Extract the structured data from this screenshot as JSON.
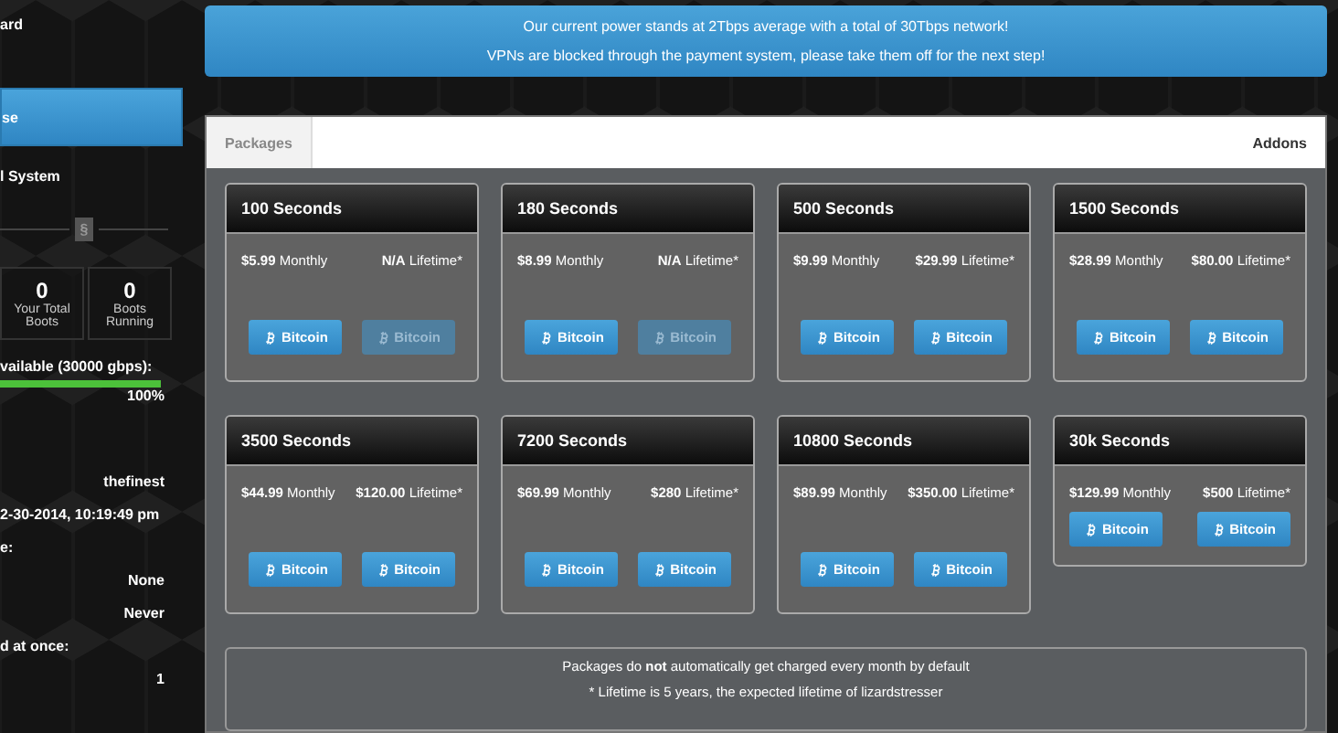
{
  "sidebar": {
    "title": "ard",
    "items": [
      {
        "label": "se",
        "selected": true
      }
    ],
    "section": "l System",
    "divider_badge": "§",
    "stats": [
      {
        "value": "0",
        "label": "Your Total Boots"
      },
      {
        "value": "0",
        "label": "Boots Running"
      }
    ],
    "capacity": {
      "label": "vailable (30000 gbps):",
      "level": 1,
      "reading": "100%"
    },
    "info": [
      {
        "kind": "value",
        "text": "thefinest"
      },
      {
        "kind": "label",
        "text": "2-30-2014, 10:19:49 pm"
      },
      {
        "kind": "label",
        "text": "e:"
      },
      {
        "kind": "value",
        "text": "None"
      },
      {
        "kind": "value",
        "text": "Never"
      },
      {
        "kind": "label",
        "text": "d at once:"
      },
      {
        "kind": "value",
        "text": "1"
      }
    ]
  },
  "banner": [
    "Our current power stands at 2Tbps average with a total of 30Tbps network!",
    "VPNs are blocked through the payment system, please take them off for the next step!"
  ],
  "tabs": [
    {
      "label": "Packages",
      "selected": true
    },
    {
      "label": "Addons",
      "selected": false
    }
  ],
  "packages": [
    {
      "kind": "standard",
      "title": "100 Seconds",
      "monthly": "**$5.99** Monthly",
      "lifetime": "**N/A** Lifetime*",
      "buttons": [
        {
          "label": "Bitcoin",
          "disabled": false
        },
        {
          "label": "Bitcoin",
          "disabled": true
        }
      ]
    },
    {
      "kind": "standard",
      "title": "180 Seconds",
      "monthly": "**$8.99** Monthly",
      "lifetime": "**N/A** Lifetime*",
      "buttons": [
        {
          "label": "Bitcoin",
          "disabled": false
        },
        {
          "label": "Bitcoin",
          "disabled": true
        }
      ]
    },
    {
      "kind": "standard",
      "title": "500 Seconds",
      "monthly": "**$9.99** Monthly",
      "lifetime": "**$29.99** Lifetime*",
      "buttons": [
        {
          "label": "Bitcoin",
          "disabled": false
        },
        {
          "label": "Bitcoin",
          "disabled": false
        }
      ]
    },
    {
      "kind": "standard",
      "title": "1500 Seconds",
      "monthly": "**$28.99** Monthly",
      "lifetime": "**$80.00** Lifetime*",
      "buttons": [
        {
          "label": "Bitcoin",
          "disabled": false
        },
        {
          "label": "Bitcoin",
          "disabled": false
        }
      ]
    },
    {
      "kind": "standard",
      "title": "3500 Seconds",
      "monthly": "**$44.99** Monthly",
      "lifetime": "**$120.00** Lifetime*",
      "buttons": [
        {
          "label": "Bitcoin",
          "disabled": false
        },
        {
          "label": "Bitcoin",
          "disabled": false
        }
      ]
    },
    {
      "kind": "standard",
      "title": "7200 Seconds",
      "monthly": "**$69.99** Monthly",
      "lifetime": "**$280** Lifetime*",
      "buttons": [
        {
          "label": "Bitcoin",
          "disabled": false
        },
        {
          "label": "Bitcoin",
          "disabled": false
        }
      ]
    },
    {
      "kind": "standard",
      "title": "10800 Seconds",
      "monthly": "**$89.99** Monthly",
      "lifetime": "**$350.00** Lifetime*",
      "buttons": [
        {
          "label": "Bitcoin",
          "disabled": false
        },
        {
          "label": "Bitcoin",
          "disabled": false
        }
      ]
    },
    {
      "kind": "compact",
      "title": "30k Seconds",
      "monthly": "**$129.99** Monthly",
      "lifetime": "**$500** Lifetime*",
      "buttons": [
        {
          "label": "Bitcoin",
          "disabled": false
        },
        {
          "label": "Bitcoin",
          "disabled": false
        }
      ]
    }
  ],
  "notes": [
    "Packages do **not** automatically get charged every month by default",
    "* Lifetime is 5 years, the expected lifetime of lizardstresser"
  ]
}
